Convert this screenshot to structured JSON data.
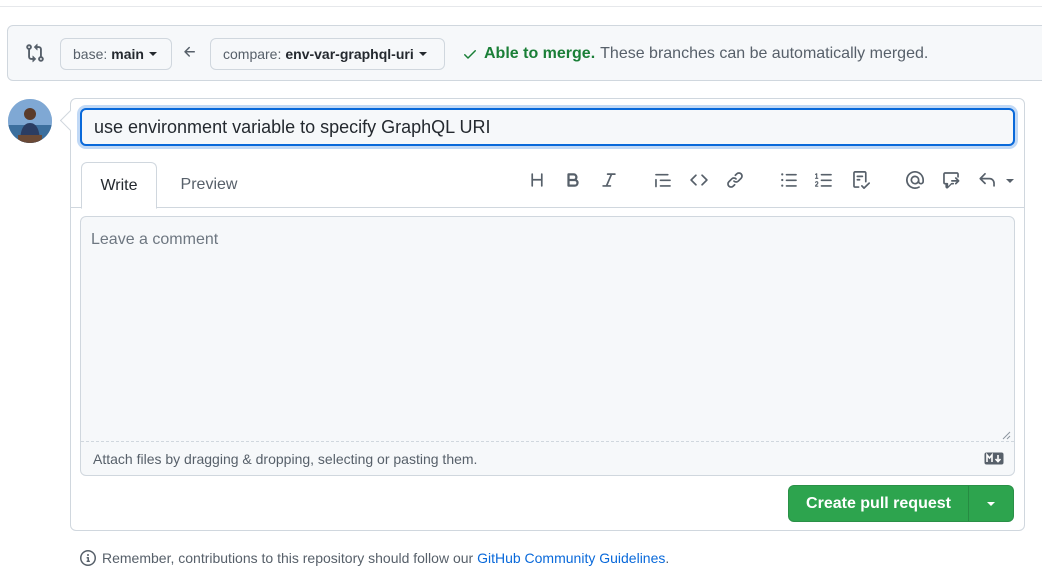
{
  "compare": {
    "base_label": "base:",
    "base_value": "main",
    "compare_label": "compare:",
    "compare_value": "env-var-graphql-uri",
    "merge_ok": "Able to merge.",
    "merge_desc": "These branches can be automatically merged."
  },
  "form": {
    "title_value": "use environment variable to specify GraphQL URI",
    "tabs": [
      "Write",
      "Preview"
    ],
    "comment_placeholder": "Leave a comment",
    "attach_text": "Attach files by dragging & dropping, selecting or pasting them."
  },
  "toolbar": [
    "heading-icon",
    "bold-icon",
    "italic-icon",
    "quote-icon",
    "code-icon",
    "link-icon",
    "bulleted-list-icon",
    "numbered-list-icon",
    "task-list-icon",
    "mention-icon",
    "reference-icon",
    "saved-replies-icon"
  ],
  "actions": {
    "create_label": "Create pull request"
  },
  "footer": {
    "note_prefix": "Remember, contributions to this repository should follow our",
    "link_text": "GitHub Community Guidelines",
    "note_suffix": "."
  },
  "colors": {
    "accent": "#0969da",
    "success": "#1a7f37",
    "button": "#2da44e"
  }
}
